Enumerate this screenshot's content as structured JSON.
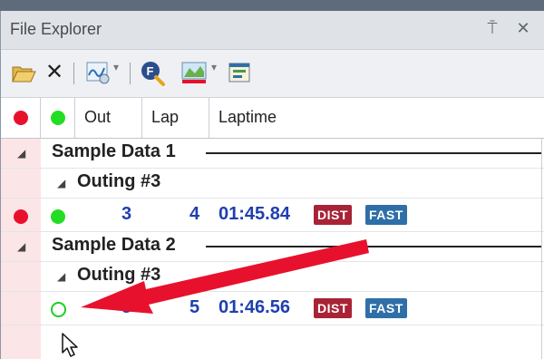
{
  "window": {
    "title": "File Explorer",
    "pin_glyph": "⍑",
    "close_glyph": "✕"
  },
  "toolbar": {
    "delete_glyph": "✕",
    "dropdown_glyph": "▾"
  },
  "columns": {
    "out": "Out",
    "lap": "Lap",
    "laptime": "Laptime"
  },
  "groups": [
    {
      "name": "Sample Data 1",
      "outing": "Outing #3",
      "lap_row": {
        "out": "3",
        "lap": "4",
        "laptime": "01:45.84",
        "badges": [
          "DIST",
          "FAST"
        ],
        "red_marker": true,
        "green_marker": "filled"
      }
    },
    {
      "name": "Sample Data 2",
      "outing": "Outing #3",
      "lap_row": {
        "out": "3",
        "lap": "5",
        "laptime": "01:46.56",
        "badges": [
          "DIST",
          "FAST"
        ],
        "red_marker": false,
        "green_marker": "outline"
      }
    }
  ],
  "tree_glyph": "◢",
  "colors": {
    "red_marker": "#e8112d",
    "green_marker": "#22dd22",
    "value_text": "#1f3fb0",
    "dist_badge": "#a82336",
    "fast_badge": "#2f6fa8",
    "annotation_arrow": "#e8112d"
  }
}
